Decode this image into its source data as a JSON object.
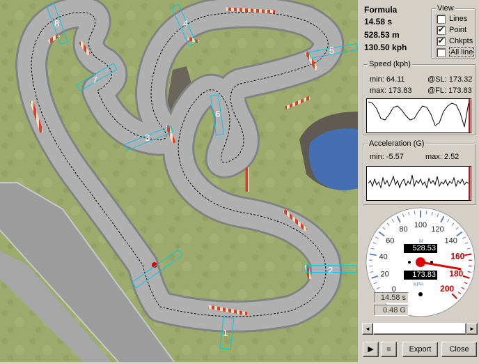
{
  "info": {
    "car": "Formula",
    "time": "14.58 s",
    "distance": "528.53 m",
    "speed": "130.50 kph"
  },
  "view": {
    "title": "View",
    "options": [
      {
        "label": "Lines",
        "checked": false
      },
      {
        "label": "Point",
        "checked": true
      },
      {
        "label": "Chkpts",
        "checked": true
      },
      {
        "label": "All line",
        "checked": false
      }
    ]
  },
  "speed_box": {
    "title": "Speed (kph)",
    "min_label": "min: 64.11",
    "max_label": "max: 173.83",
    "sl_label": "@SL: 173.32",
    "fl_label": "@FL: 173.83"
  },
  "accel_box": {
    "title": "Acceleration (G)",
    "min_label": "min: -5.57",
    "max_label": "max: 2.52"
  },
  "gauge": {
    "unit_top": "M",
    "unit_bottom": "KPH",
    "distance_readout": "528.53",
    "speed_readout": "173.83",
    "ticks": [
      "0",
      "20",
      "40",
      "60",
      "80",
      "100",
      "120",
      "140",
      "160",
      "180",
      "200"
    ],
    "needle_value": 173.83,
    "max_value": 200
  },
  "readouts": {
    "time": "14.58 s",
    "g": "0.48 G"
  },
  "scrollbar": {
    "left_arrow": "◄",
    "right_arrow": "►",
    "position": 0.03
  },
  "controls": {
    "play": "▶",
    "stop": "■",
    "export": "Export",
    "close": "Close"
  },
  "checkpoints": [
    "1",
    "2",
    "3",
    "4",
    "5",
    "6",
    "7",
    "8"
  ]
}
